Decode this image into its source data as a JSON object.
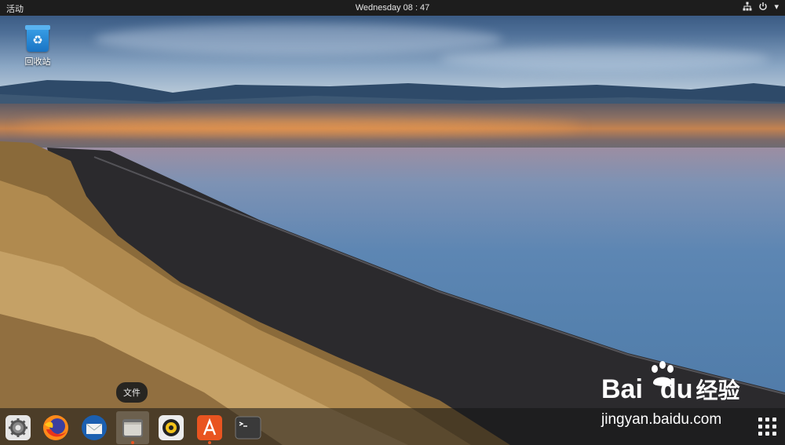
{
  "topbar": {
    "activities_label": "活动",
    "clock": "Wednesday 08 : 47",
    "network_icon": "network-icon",
    "power_icon": "power-icon",
    "menu_caret": "▾"
  },
  "desktop": {
    "trash_label": "回收站",
    "trash_icon": "recycle-bin-icon"
  },
  "dock": {
    "tooltip": "文件",
    "items": [
      {
        "name": "settings",
        "icon": "gear-icon"
      },
      {
        "name": "firefox",
        "icon": "firefox-icon"
      },
      {
        "name": "thunderbird",
        "icon": "mail-icon"
      },
      {
        "name": "files",
        "icon": "folder-icon"
      },
      {
        "name": "rhythmbox",
        "icon": "music-icon"
      },
      {
        "name": "software",
        "icon": "software-center-icon"
      },
      {
        "name": "terminal",
        "icon": "terminal-icon"
      }
    ],
    "show_apps_icon": "app-grid-icon",
    "accent": "#e95420"
  },
  "watermark": {
    "brand": "Bai",
    "brand2": "du",
    "product": "经验",
    "url": "jingyan.baidu.com"
  }
}
